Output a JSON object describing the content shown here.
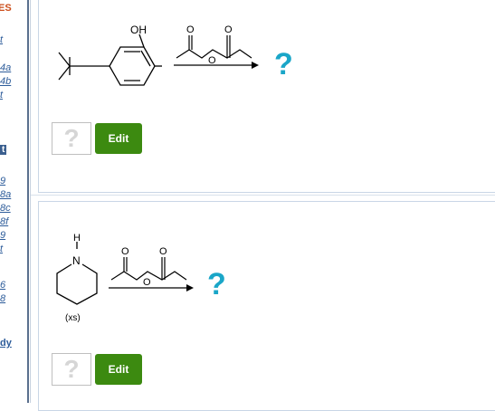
{
  "sidebar": {
    "header": "ES",
    "items": [
      "t",
      "4a",
      "4b",
      "t",
      "t",
      "9",
      "8a",
      "8c",
      "8f",
      "9",
      "t",
      "6",
      "8",
      "dy"
    ]
  },
  "problems": [
    {
      "reactant_label": "OH",
      "help_symbol": "?",
      "edit_label": "Edit",
      "answer_mark": "?"
    },
    {
      "reactant_label_n": "N",
      "reactant_label_h": "H",
      "reactant_note": "(xs)",
      "help_symbol": "?",
      "edit_label": "Edit",
      "answer_mark": "?"
    }
  ],
  "reagent_labels": {
    "o": "O"
  }
}
